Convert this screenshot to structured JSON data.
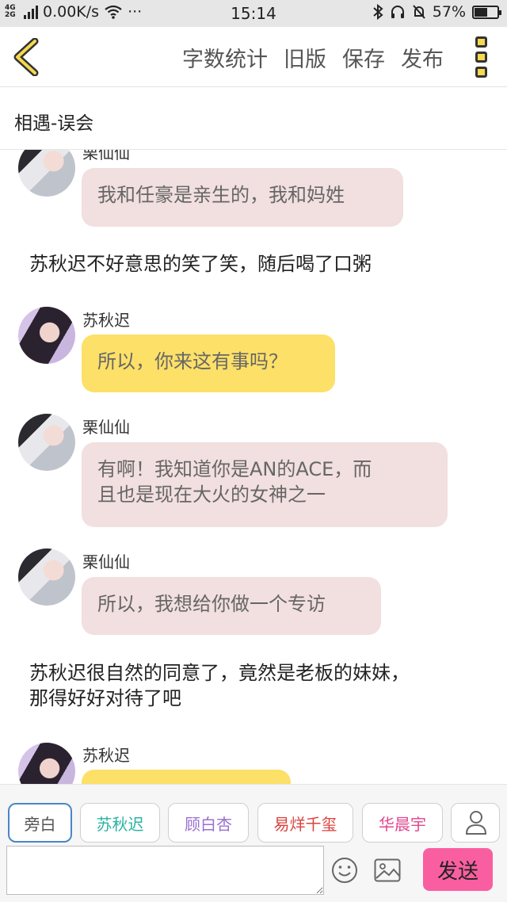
{
  "status_bar": {
    "network": "4G 2G",
    "speed": "0.00K/s",
    "dots": "···",
    "time": "15:14",
    "battery": "57%",
    "battery_level": 0.57
  },
  "toolbar": {
    "back_icon": "chevron-left-icon",
    "word_count": "字数统计",
    "old_version": "旧版",
    "save": "保存",
    "publish": "发布",
    "more_icon": "more-vertical-icon"
  },
  "chapter": {
    "title": "相遇-误会"
  },
  "messages": [
    {
      "type": "speech",
      "speaker": "栗仙仙",
      "text": "我和任豪是亲生的，我和妈姓",
      "color": "#f2dfdf"
    },
    {
      "type": "narration",
      "text": "苏秋迟不好意思的笑了笑，随后喝了口粥"
    },
    {
      "type": "speech",
      "speaker": "苏秋迟",
      "text": "所以，你来这有事吗？",
      "color": "#fce068"
    },
    {
      "type": "speech",
      "speaker": "栗仙仙",
      "text1": "有啊！我知道你是AN的ACE，而",
      "text2": "且也是现在大火的女神之一",
      "color": "#f2dfdf"
    },
    {
      "type": "speech",
      "speaker": "栗仙仙",
      "text": "所以，我想给你做一个专访",
      "color": "#f2dfdf"
    },
    {
      "type": "narration",
      "text1": "苏秋迟很自然的同意了，竟然是老板的妹妹，",
      "text2": "那得好好对待了吧"
    },
    {
      "type": "speech",
      "speaker": "苏秋迟",
      "text": "",
      "color": "#fce068"
    }
  ],
  "characters": [
    {
      "label": "旁白",
      "color": "#555555",
      "selected": true
    },
    {
      "label": "苏秋迟",
      "color": "#2bb3a3"
    },
    {
      "label": "顾白杏",
      "color": "#9b6fcf"
    },
    {
      "label": "易烊千玺",
      "color": "#d9433d"
    },
    {
      "label": "华晨宇",
      "color": "#e0468f"
    }
  ],
  "input": {
    "value": "",
    "placeholder": ""
  },
  "send_label": "发送"
}
